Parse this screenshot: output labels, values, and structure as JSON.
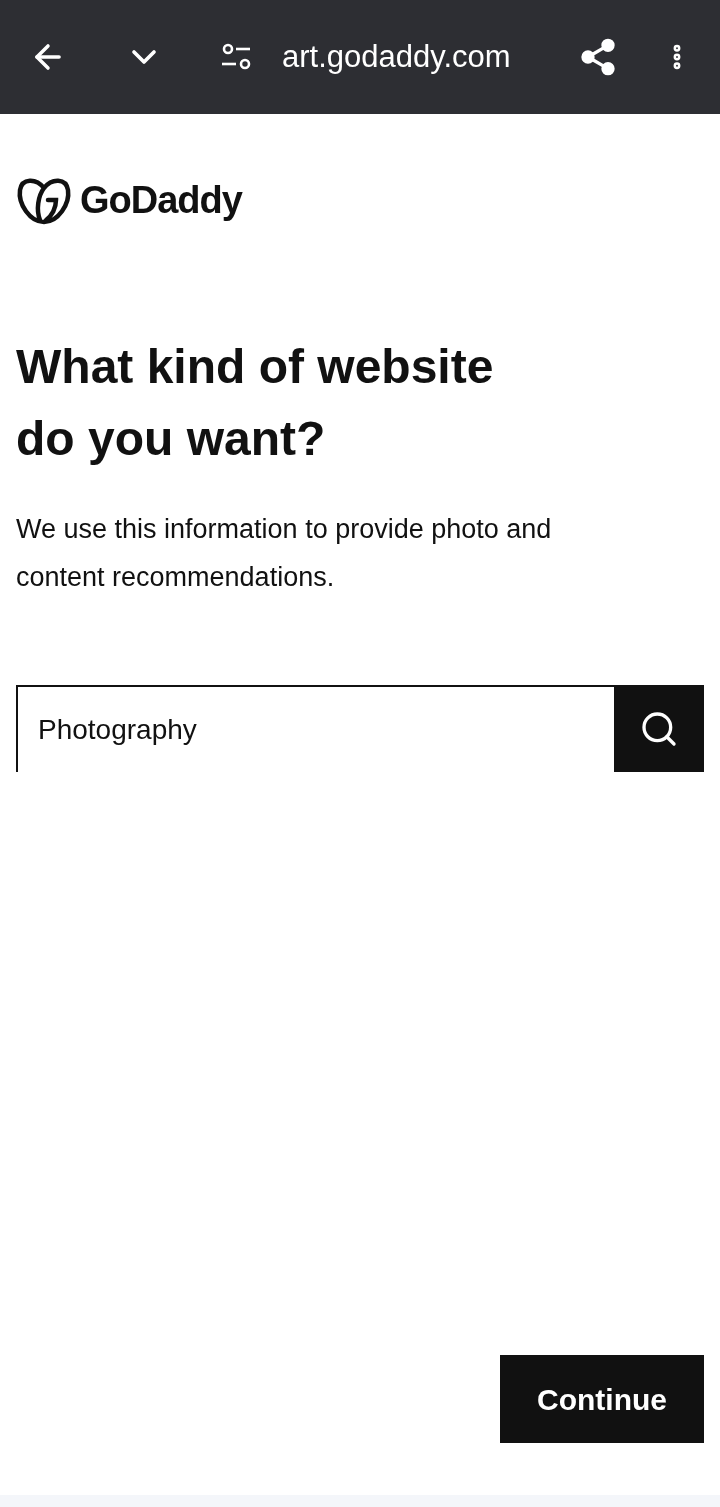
{
  "browser_bar": {
    "url": "art.godaddy.com"
  },
  "logo": {
    "wordmark": "GoDaddy"
  },
  "heading": "What kind of website do you want?",
  "description": "We use this information to provide photo and content recommendations.",
  "search": {
    "value": "Photography"
  },
  "continue_button": "Continue"
}
